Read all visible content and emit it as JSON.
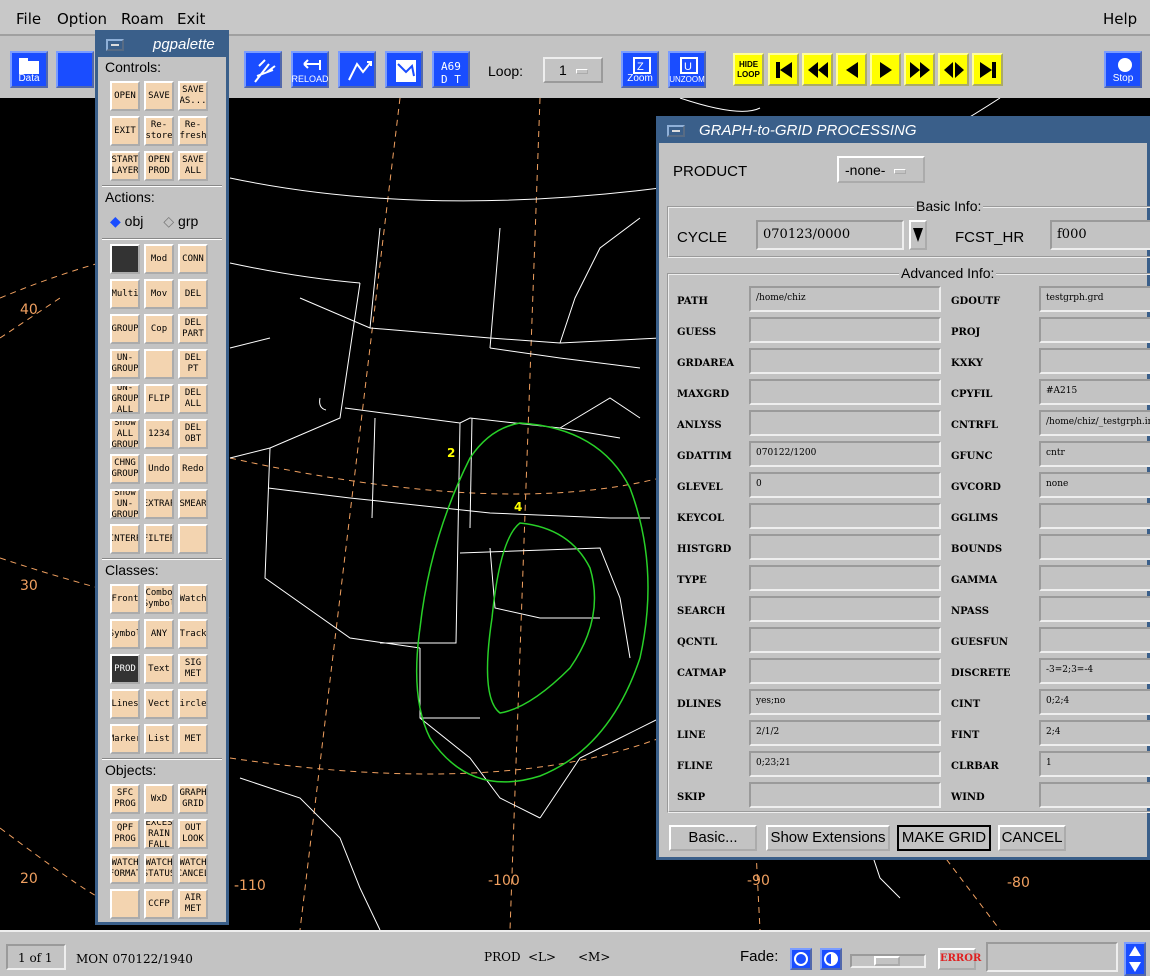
{
  "menu": {
    "file": "File",
    "option": "Option",
    "roam": "Roam",
    "exit": "Exit",
    "help": "Help"
  },
  "toolbar": {
    "data": "Data",
    "reload": "RELOAD",
    "loop_label": "Loop:",
    "loop_value": "1",
    "zoom": "Zoom",
    "unzoom": "UNZOOM",
    "hide_loop_top": "HIDE",
    "hide_loop_bottom": "LOOP",
    "stop": "Stop"
  },
  "palette": {
    "title": "pgpalette",
    "controls": "Controls:",
    "actions": "Actions:",
    "obj": "obj",
    "grp": "grp",
    "classes": "Classes:",
    "objects": "Objects:",
    "control_btns": [
      "OPEN",
      "SAVE",
      "SAVE AS...",
      "EXIT",
      "Re-store",
      "Re-fresh",
      "START LAYER",
      "OPEN PROD",
      "SAVE ALL"
    ],
    "action_btns": [
      "",
      "Mod",
      "CONN",
      "Multi",
      "Mov",
      "DEL",
      "GROUP",
      "Cop",
      "DEL PART",
      "UN-GROUP",
      "",
      "DEL PT",
      "UN-GROUP ALL",
      "FLIP",
      "DEL ALL",
      "Show ALL GROUP",
      "1234",
      "DEL OBT",
      "CHNG GROUP",
      "Undo",
      "Redo",
      "Show UN-GROUP",
      "EXTRAP",
      "SMEAR",
      "INTERP",
      "FILTER",
      ""
    ],
    "class_btns": [
      "Front",
      "Combo Symbol",
      "Watch",
      "Symbol",
      "ANY",
      "Track",
      "PROD",
      "Text",
      "SIG MET",
      "Lines",
      "Vect",
      "Circles",
      "Marker",
      "List",
      "MET"
    ],
    "object_btns": [
      "SFC PROG",
      "WxD",
      "GRAPH GRID",
      "QPF PROG",
      "EXCES RAIN FALL",
      "OUT LOOK",
      "WATCH FORMAT",
      "WATCH STATUS",
      "WATCH CANCEL",
      "",
      "CCFP",
      "AIR MET"
    ]
  },
  "map": {
    "lat_40": "40",
    "lat_30": "30",
    "lat_20": "20",
    "lon_110": "-110",
    "lon_100": "-100",
    "lon_90": "-90",
    "lon_80": "-80",
    "contour_2": "2",
    "contour_4": "4"
  },
  "dialog": {
    "title": "GRAPH-to-GRID PROCESSING",
    "product_label": "PRODUCT",
    "product_value": "-none-",
    "basic_info": "Basic Info:",
    "cycle_label": "CYCLE",
    "cycle_value": "070123/0000",
    "fcst_label": "FCST_HR",
    "fcst_value": "f000",
    "advanced_info": "Advanced Info:",
    "left_fields": [
      {
        "label": "PATH",
        "value": "/home/chiz"
      },
      {
        "label": "GUESS",
        "value": ""
      },
      {
        "label": "GRDAREA",
        "value": ""
      },
      {
        "label": "MAXGRD",
        "value": ""
      },
      {
        "label": "ANLYSS",
        "value": ""
      },
      {
        "label": "GDATTIM",
        "value": "070122/1200"
      },
      {
        "label": "GLEVEL",
        "value": "0"
      },
      {
        "label": "KEYCOL",
        "value": ""
      },
      {
        "label": "HISTGRD",
        "value": ""
      },
      {
        "label": "TYPE",
        "value": ""
      },
      {
        "label": "SEARCH",
        "value": ""
      },
      {
        "label": "QCNTL",
        "value": ""
      },
      {
        "label": "CATMAP",
        "value": ""
      },
      {
        "label": "DLINES",
        "value": "yes;no"
      },
      {
        "label": "LINE",
        "value": "2/1/2"
      },
      {
        "label": "FLINE",
        "value": "0;23;21"
      },
      {
        "label": "SKIP",
        "value": ""
      }
    ],
    "right_fields": [
      {
        "label": "GDOUTF",
        "value": "testgrph.grd"
      },
      {
        "label": "PROJ",
        "value": ""
      },
      {
        "label": "KXKY",
        "value": ""
      },
      {
        "label": "CPYFIL",
        "value": "#A215"
      },
      {
        "label": "CNTRFL",
        "value": "/home/chiz/_testgrph.info"
      },
      {
        "label": "GFUNC",
        "value": "cntr"
      },
      {
        "label": "GVCORD",
        "value": "none"
      },
      {
        "label": "GGLIMS",
        "value": ""
      },
      {
        "label": "BOUNDS",
        "value": ""
      },
      {
        "label": "GAMMA",
        "value": ""
      },
      {
        "label": "NPASS",
        "value": ""
      },
      {
        "label": "GUESFUN",
        "value": ""
      },
      {
        "label": "DISCRETE",
        "value": "-3=2;3=-4"
      },
      {
        "label": "CINT",
        "value": "0;2;4"
      },
      {
        "label": "FINT",
        "value": "2;4"
      },
      {
        "label": "CLRBAR",
        "value": "1"
      },
      {
        "label": "WIND",
        "value": ""
      }
    ],
    "basic_btn": "Basic...",
    "ext_btn": "Show Extensions",
    "make_btn": "MAKE GRID",
    "cancel_btn": "CANCEL"
  },
  "status": {
    "frame": "1 of 1",
    "datetime": "MON 070122/1940",
    "prod": "PROD",
    "l": "<L>",
    "m": "<M>",
    "fade": "Fade:",
    "error": "ERROR"
  }
}
